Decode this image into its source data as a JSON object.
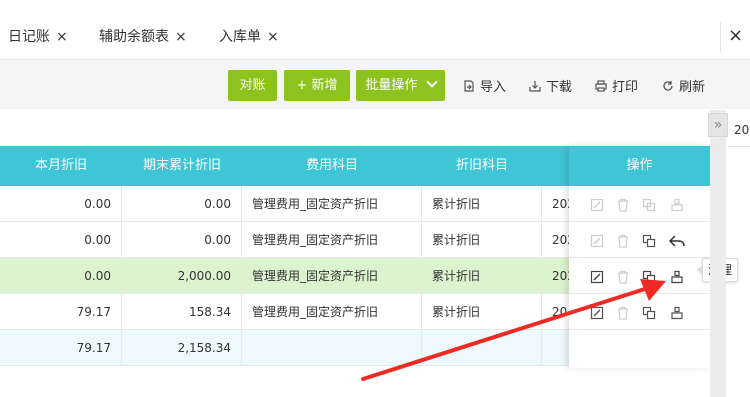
{
  "tabs": [
    {
      "label": "日记账",
      "close": "×"
    },
    {
      "label": "辅助余额表",
      "close": "×"
    },
    {
      "label": "入库单",
      "close": "×"
    }
  ],
  "window_close": "×",
  "toolbar": {
    "reconcile": "对账",
    "add": "+ 新增",
    "batch": "批量操作",
    "import": "导入",
    "download": "下载",
    "print": "打印",
    "refresh": "刷新"
  },
  "columns": {
    "monthly_dep": "本月折旧",
    "accum_end": "期末累计折旧",
    "expense_account": "费用科目",
    "dep_account": "折旧科目",
    "operations": "操作"
  },
  "rows": [
    {
      "monthly": "0.00",
      "accum": "0.00",
      "expense": "管理费用_固定资产折旧",
      "dep": "累计折旧",
      "date": "202"
    },
    {
      "monthly": "0.00",
      "accum": "0.00",
      "expense": "管理费用_固定资产折旧",
      "dep": "累计折旧",
      "date": "202"
    },
    {
      "monthly": "0.00",
      "accum": "2,000.00",
      "expense": "管理费用_固定资产折旧",
      "dep": "累计折旧",
      "date": "202"
    },
    {
      "monthly": "79.17",
      "accum": "158.34",
      "expense": "管理费用_固定资产折旧",
      "dep": "累计折旧",
      "date": "20"
    }
  ],
  "summary": {
    "monthly": "79.17",
    "accum": "2,158.34"
  },
  "tooltip": "清理",
  "side_panel": "20",
  "collapse_icon": "»",
  "colors": {
    "header": "#3ec6d6",
    "button": "#8dc21f",
    "highlight": "#dcf3cf",
    "arrow": "#ee2a24"
  }
}
